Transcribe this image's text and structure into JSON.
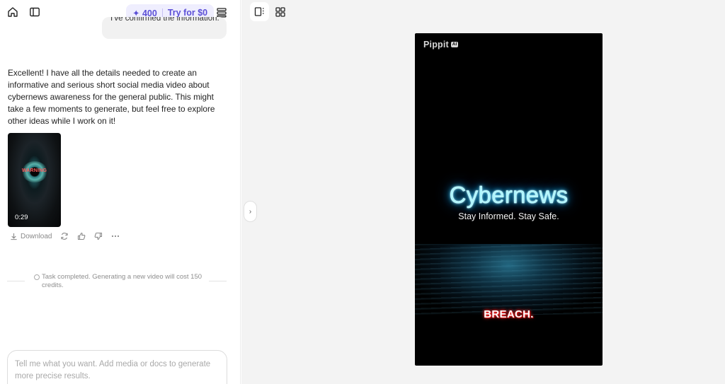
{
  "toolbar": {
    "credits_count": "400",
    "credits_star": "✦",
    "try_label": "Try for $0"
  },
  "chat": {
    "user_message": "I've confirmed the information.",
    "ai_message": "Excellent! I have all the details needed to create an informative and serious short social media video about cybernews awareness for the general public. This might take a few moments to generate, but feel free to explore other ideas while I work on it!",
    "video_thumb": {
      "warning_text": "WARNING",
      "duration": "0:29"
    },
    "actions": {
      "download_label": "Download"
    },
    "status_text": "Task completed. Generating a new video will cost 150 credits."
  },
  "input": {
    "placeholder": "Tell me what you want. Add media or docs to generate more precise results."
  },
  "preview": {
    "logo_text": "Pippit",
    "logo_badge": "AI",
    "headline": "Cybernews",
    "tagline": "Stay Informed. Stay Safe.",
    "caption": "BREACH.",
    "collapse_glyph": "›"
  },
  "colors": {
    "accent": "#5b4fd6",
    "credits_bg": "#efeefe",
    "preview_bg": "#f3f3f3",
    "neon": "#aef6ff",
    "breach_glow": "#ff2a2a"
  }
}
